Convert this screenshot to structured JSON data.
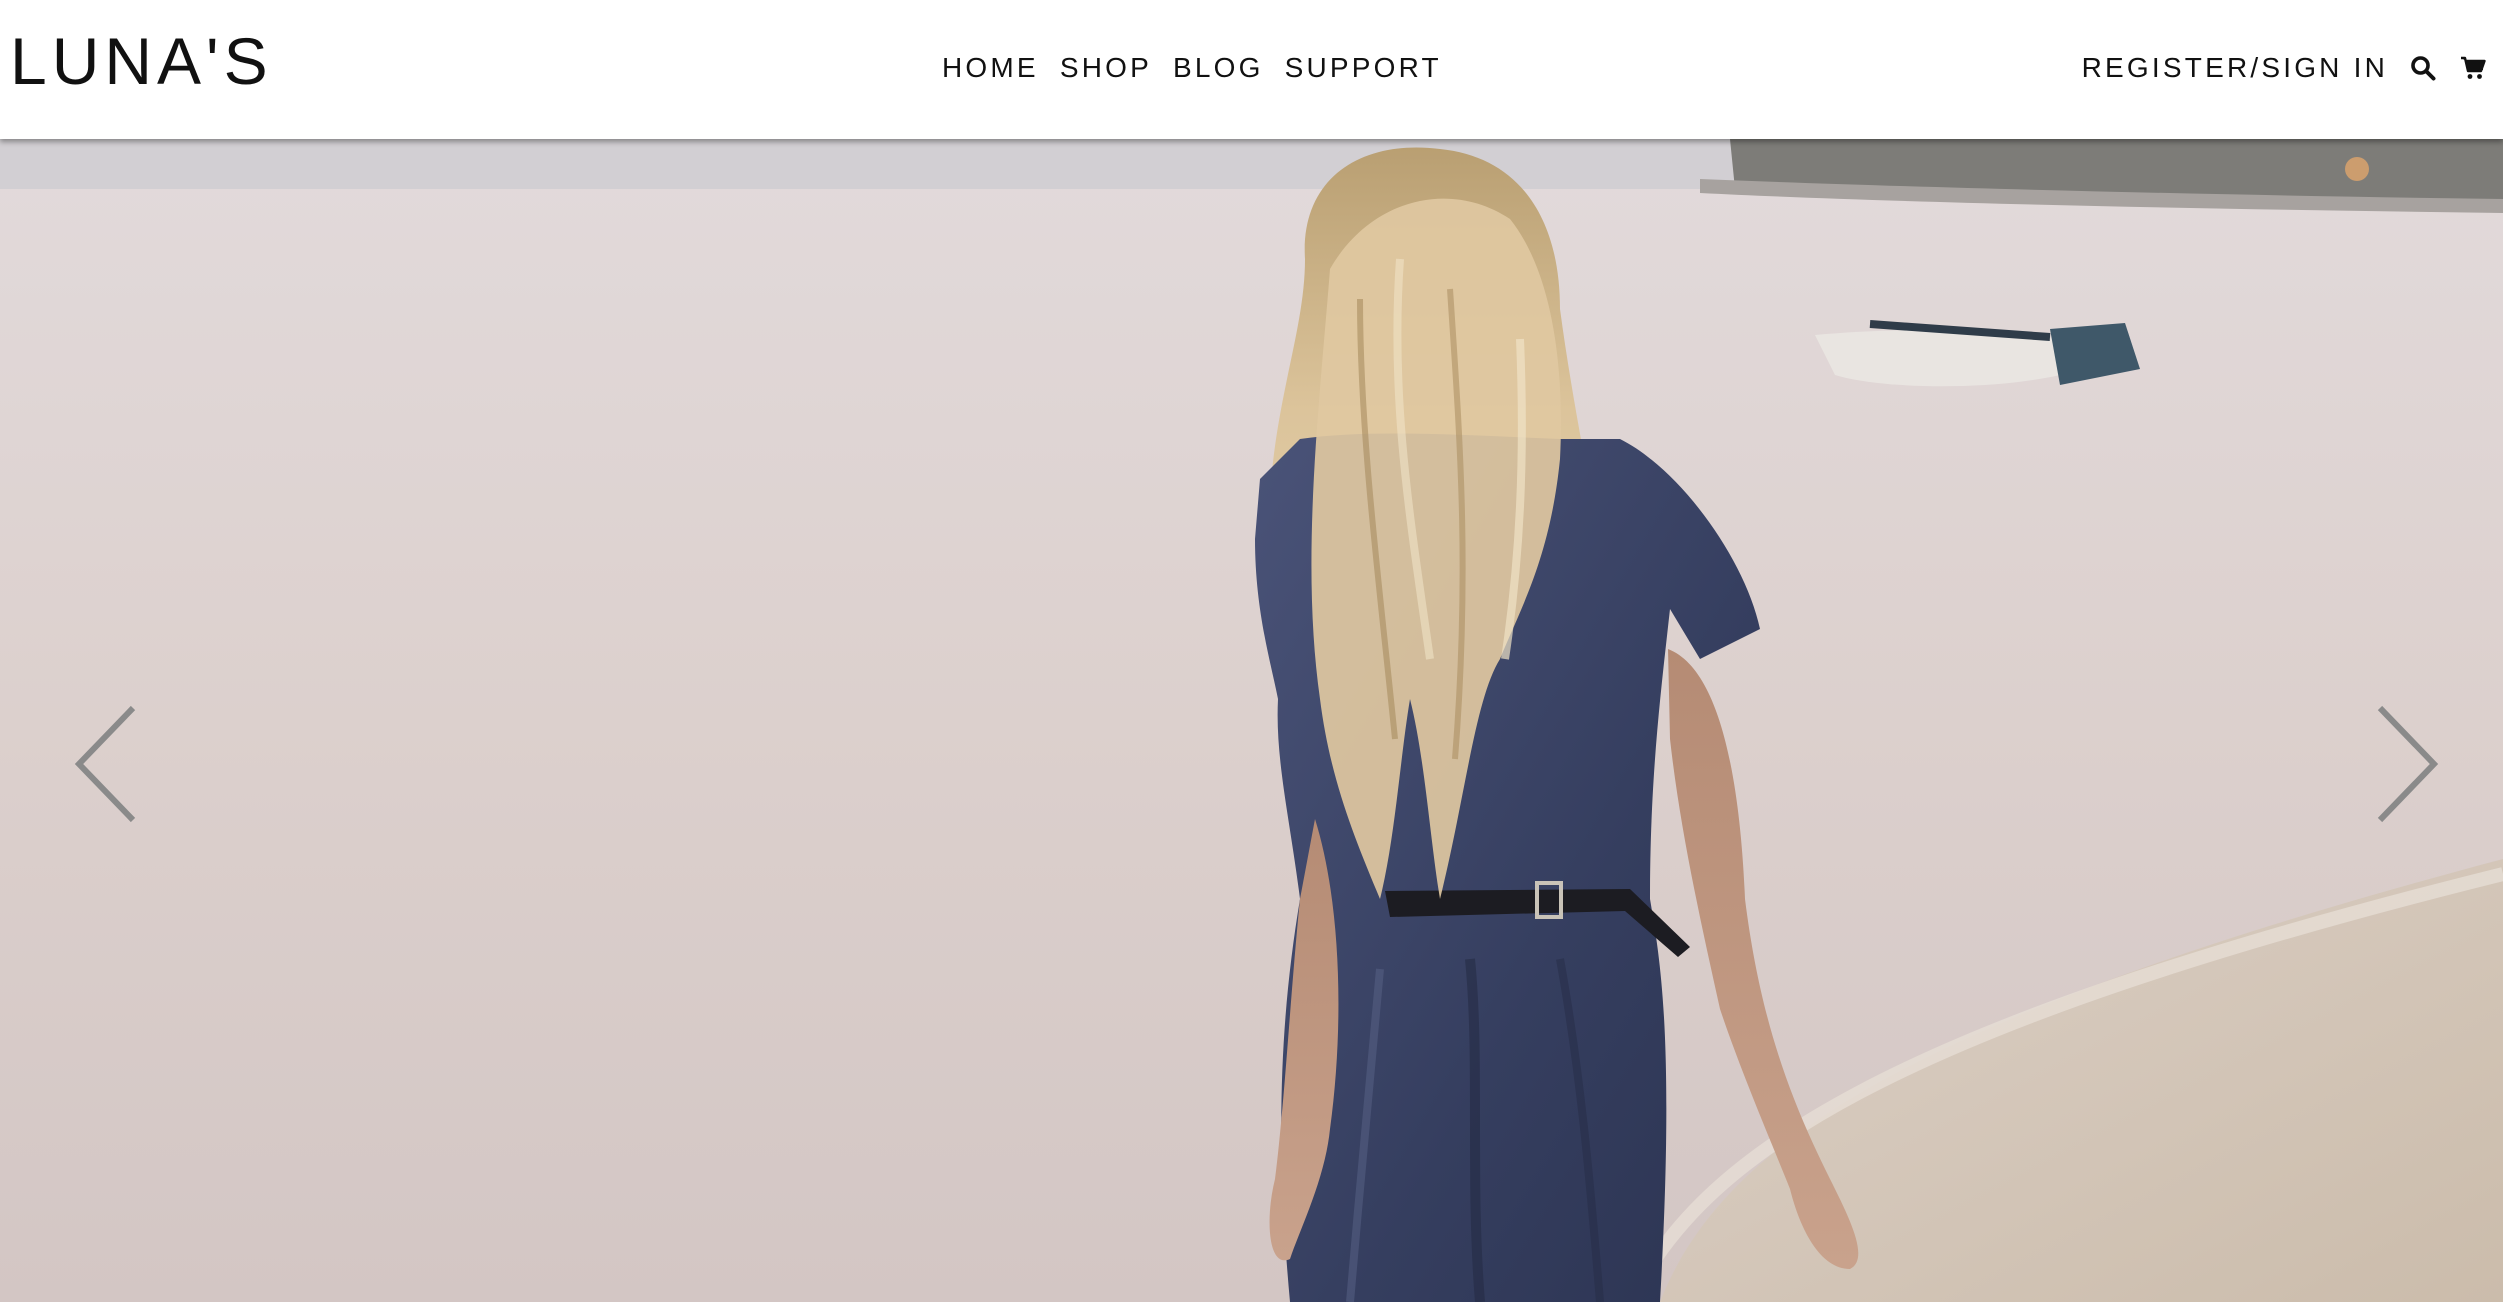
{
  "header": {
    "logo": "LUNA'S",
    "nav": [
      {
        "label": "HOME"
      },
      {
        "label": "SHOP"
      },
      {
        "label": "BLOG"
      },
      {
        "label": "SUPPORT"
      }
    ],
    "account_label": "REGISTER/SIGN IN",
    "search_icon": "search-icon",
    "cart_icon": "cart-icon"
  },
  "hero": {
    "prev_icon": "chevron-left-icon",
    "next_icon": "chevron-right-icon"
  },
  "colors": {
    "text": "#111111",
    "arrow": "#8a8a8a",
    "sky": "#d9d3d4",
    "water": "#dcd1cf",
    "sand": "#d6c8bb",
    "dress": "#3b4466",
    "hair": "#d6bd93"
  }
}
